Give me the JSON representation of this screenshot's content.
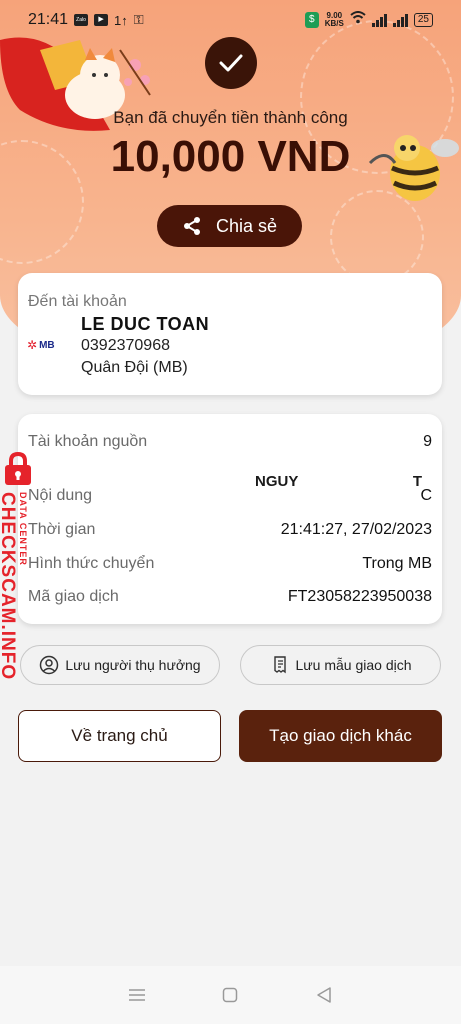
{
  "status_bar": {
    "time": "21:41",
    "net_speed_value": "9.00",
    "net_speed_unit": "KB/S",
    "battery": "25",
    "app_icon_labels": [
      "Zalo"
    ]
  },
  "hero": {
    "success_message": "Bạn đã chuyển tiền thành công",
    "amount": "10,000 VND",
    "share_label": "Chia sẻ"
  },
  "destination": {
    "title": "Đến tài khoản",
    "bank_logo_text": "MB",
    "name": "LE DUC TOAN",
    "account_number": "0392370968",
    "bank": "Quân Đội (MB)"
  },
  "details": {
    "source_label": "Tài khoản nguồn",
    "source_value_partial": "9",
    "source_name_partial": "NGUY",
    "source_name_end": "T",
    "content_label": "Nội dung",
    "content_value": "C",
    "time_label": "Thời gian",
    "time_value": "21:41:27, 27/02/2023",
    "method_label": "Hình thức chuyển",
    "method_value": "Trong MB",
    "code_label": "Mã giao dịch",
    "code_value": "FT23058223950038"
  },
  "actions": {
    "save_beneficiary": "Lưu người thụ hưởng",
    "save_template": "Lưu mẫu giao dịch",
    "home": "Về trang chủ",
    "new_transaction": "Tạo giao dịch khác"
  },
  "watermark": {
    "main": "CHECKSCAM.INFO",
    "sub": "DATA CENTER"
  },
  "icons": [
    "check-icon",
    "share-icon",
    "user-circle-icon",
    "receipt-icon",
    "menu-icon",
    "home-square-icon",
    "back-triangle-icon",
    "lock-icon"
  ],
  "colors": {
    "hero_bg": "#f6a37a",
    "primary_dark": "#4a1508",
    "watermark_red": "#e5232b"
  }
}
